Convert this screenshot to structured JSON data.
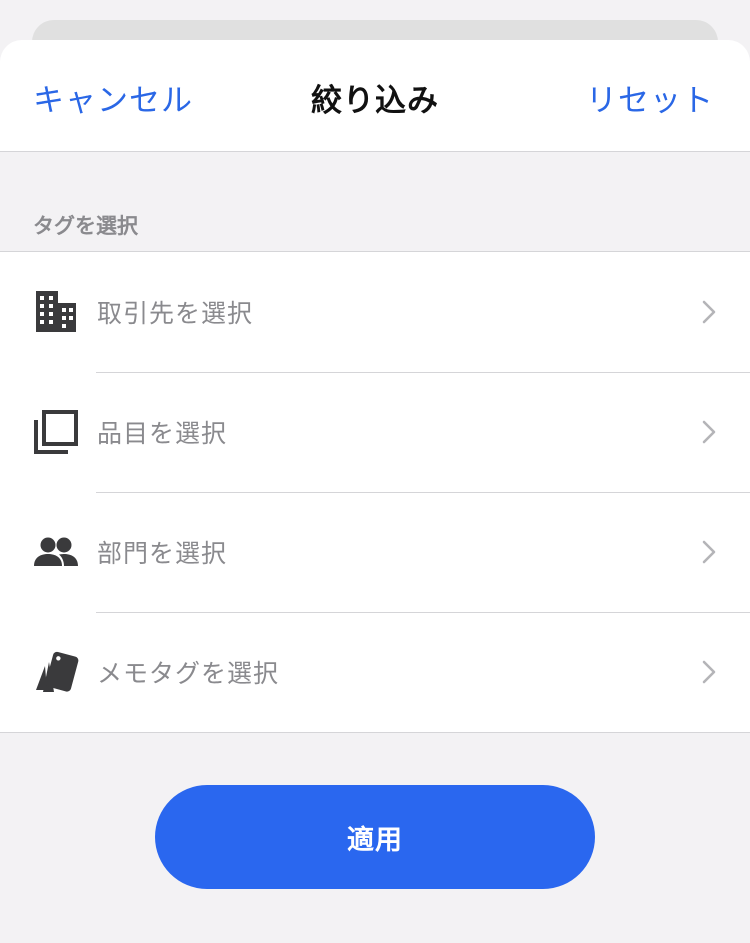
{
  "header": {
    "cancel_label": "キャンセル",
    "title": "絞り込み",
    "reset_label": "リセット"
  },
  "section": {
    "label": "タグを選択"
  },
  "rows": [
    {
      "icon": "building-icon",
      "placeholder": "取引先を選択"
    },
    {
      "icon": "item-stack-icon",
      "placeholder": "品目を選択"
    },
    {
      "icon": "people-icon",
      "placeholder": "部門を選択"
    },
    {
      "icon": "tag-cards-icon",
      "placeholder": "メモタグを選択"
    }
  ],
  "apply": {
    "label": "適用"
  },
  "colors": {
    "accent": "#2a67ef",
    "link": "#2a67e6",
    "placeholder_text": "#8a8a8e",
    "background": "#f3f2f4"
  }
}
